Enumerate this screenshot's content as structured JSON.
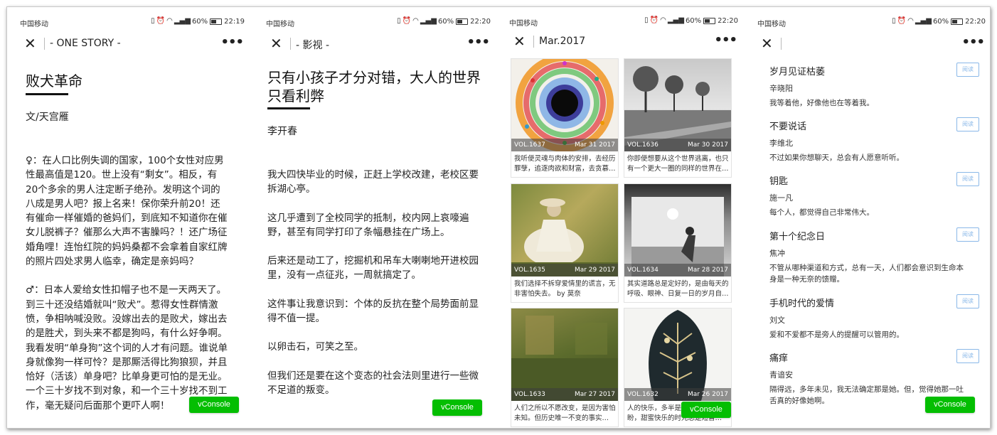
{
  "status_bar": {
    "carrier": "中国移动",
    "battery": "60%",
    "times": [
      "22:19",
      "22:20",
      "22:20",
      "22:20"
    ]
  },
  "vconsole_label": "vConsole",
  "screen1": {
    "nav_title": "- ONE STORY -",
    "title": "败犬革命",
    "author": "文/天宫雁",
    "paragraphs": [
      "♀：在人口比例失调的国家，100个女性对应男性最高值是120。世上没有“剩女”。相反，有20个多余的男人注定断子绝孙。发明这个词的八成是男人吧？报上名来！保你荣升前20！还有催命一样催婚的爸妈们，到底知不知道你在催女儿脱裤子？催那么大声不害臊吗？！还广场征婚角哩！连怡红院的妈妈桑都不会拿着自家红牌的照片四处求男人临幸，确定是亲妈吗？",
      "♂：日本人爱给女性扣帽子也不是一天两天了。到三十还没结婚就叫“败犬”。惹得女性群情激愤，争相呐喊没败。没嫁出去的是败犬，嫁出去的是胜犬，到头来不都是狗吗，有什么好争啊。我看发明“单身狗”这个词的人才有问题。谁说单身就像狗一样可怜？是那厮活得比狗狼狈，并且恰好（活该）单身吧？比单身更可怕的是无业。一个三十岁找不到对象，和一个三十岁找不到工作，毫无疑问后面那个更吓人啊！"
    ]
  },
  "screen2": {
    "nav_title": "- 影视 -",
    "title": "只有小孩子才分对错，大人的世界只看利弊",
    "author": "李开春",
    "paragraphs": [
      "我大四快毕业的时候，正赶上学校改建，老校区要拆湖心亭。",
      "这几乎遭到了全校同学的抵制，校内网上哀嚎遍野，甚至有同学打印了条幅悬挂在广场上。",
      "后来还是动工了，挖掘机和吊车大喇喇地开进校园里，没有一点征兆，一周就搞定了。",
      "这件事让我意识到：个体的反抗在整个局势面前显得不值一提。",
      "以卵击石，可笑之至。",
      "但我们还是要在这个变态的社会法则里进行一些微不足道的叛变。"
    ]
  },
  "screen3": {
    "nav_title": "Mar.2017",
    "cards": [
      {
        "vol": "VOL.1637",
        "date": "Mar 31 2017",
        "excerpt": "我听便灵魂与肉体的安排，去经历罪孽，追逐肉欲和财富，去贪慕…",
        "image": "colorful-circles-icon"
      },
      {
        "vol": "VOL.1636",
        "date": "Mar 30 2017",
        "excerpt": "你即便想要从这个世界逃离，也只有一个更大一圈的同样的世界在…",
        "image": "road-trees-icon"
      },
      {
        "vol": "VOL.1635",
        "date": "Mar 29 2017",
        "excerpt": "我们选择不拆穿爱情里的谎言，无非害怕失去。 by 莫奈",
        "image": "woman-painting-icon"
      },
      {
        "vol": "VOL.1634",
        "date": "Mar 28 2017",
        "excerpt": "其实道路总是定好的，是由每天的呼吸、眼神、日复一日的岁月自…",
        "image": "window-chair-icon"
      },
      {
        "vol": "VOL.1633",
        "date": "Mar 27 2017",
        "excerpt": "人们之所以不愿改变，是因为害怕未知。但历史唯一不变的事实…",
        "image": "green-wall-icon"
      },
      {
        "vol": "VOL.1632",
        "date": "Mar 26 2017",
        "excerpt": "人的快乐，多半是因为生活中有期盼，甜蜜快乐的时光总是短暂…",
        "image": "botanical-vase-icon"
      }
    ]
  },
  "screen4": {
    "read_label": "阅读",
    "items": [
      {
        "title": "岁月见证枯萎",
        "author": "辛晓阳",
        "desc": "我等着他，好像他也在等着我。"
      },
      {
        "title": "不要说话",
        "author": "李维北",
        "desc": "不过如果你想聊天，总会有人愿意听听。"
      },
      {
        "title": "钥匙",
        "author": "施一凡",
        "desc": "每个人，都觉得自己非常伟大。"
      },
      {
        "title": "第十个纪念日",
        "author": "焦冲",
        "desc": "不管从哪种渠道和方式，总有一天，人们都会意识到生命本身是一种无奈的馈赠。"
      },
      {
        "title": "手机时代的爱情",
        "author": "刘文",
        "desc": "爱和不爱都不是旁人的提醒可以管用的。"
      },
      {
        "title": "痛痒",
        "author": "青谙安",
        "desc": "隔得远，多年未见，我无法确定那是她。但，觉得她那一吐舌真的好像她啊。"
      }
    ]
  }
}
